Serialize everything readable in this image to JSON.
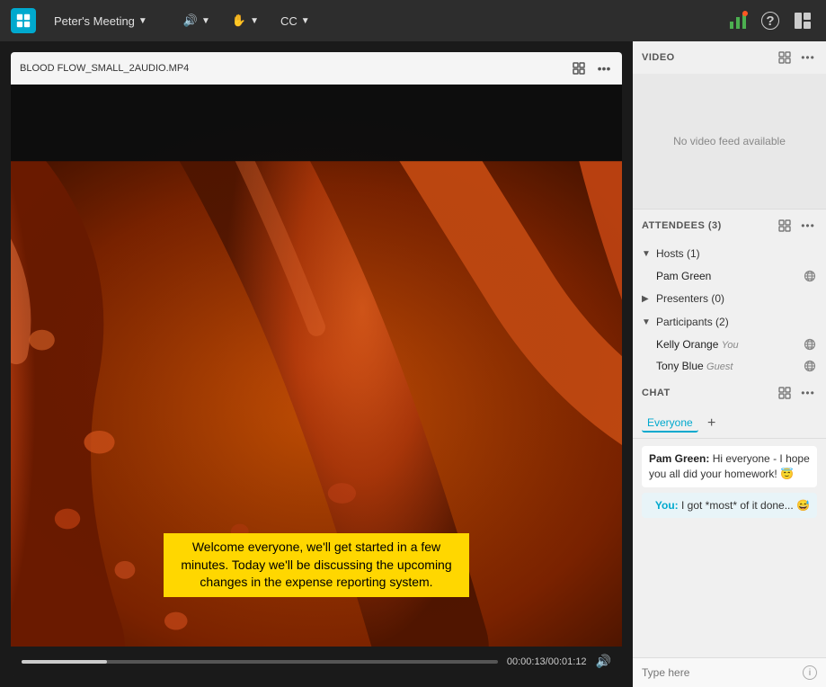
{
  "topbar": {
    "meeting_title": "Peter's Meeting",
    "audio_label": "",
    "hand_label": "",
    "cc_label": "CC",
    "icons": {
      "stats": "📊",
      "help": "?",
      "layout": "⊞"
    }
  },
  "video_panel": {
    "title": "VIDEO",
    "no_video_text": "No video feed available"
  },
  "attendees_panel": {
    "title": "ATTENDEES",
    "count": "(3)",
    "hosts_label": "Hosts (1)",
    "presenters_label": "Presenters (0)",
    "participants_label": "Participants (2)",
    "hosts": [
      {
        "name": "Pam Green",
        "role": ""
      }
    ],
    "participants": [
      {
        "name": "Kelly Orange",
        "role": "You"
      },
      {
        "name": "Tony Blue",
        "role": "Guest"
      }
    ]
  },
  "chat_panel": {
    "title": "CHAT",
    "tab_label": "Everyone",
    "messages": [
      {
        "sender": "Pam Green",
        "text": "Hi everyone - I hope you all did your homework! 😇",
        "self": false
      },
      {
        "sender": "You",
        "text": "I got *most* of it done... 😅",
        "self": true
      }
    ],
    "input_placeholder": "Type here"
  },
  "media_player": {
    "filename": "BLOOD FLOW_SMALL_2AUDIO.MP4",
    "time_current": "00:00:13",
    "time_total": "00:01:12",
    "caption": "Welcome everyone, we'll get started in a few minutes. Today we'll be discussing the upcoming changes in the expense reporting system.",
    "progress_percent": 18
  }
}
